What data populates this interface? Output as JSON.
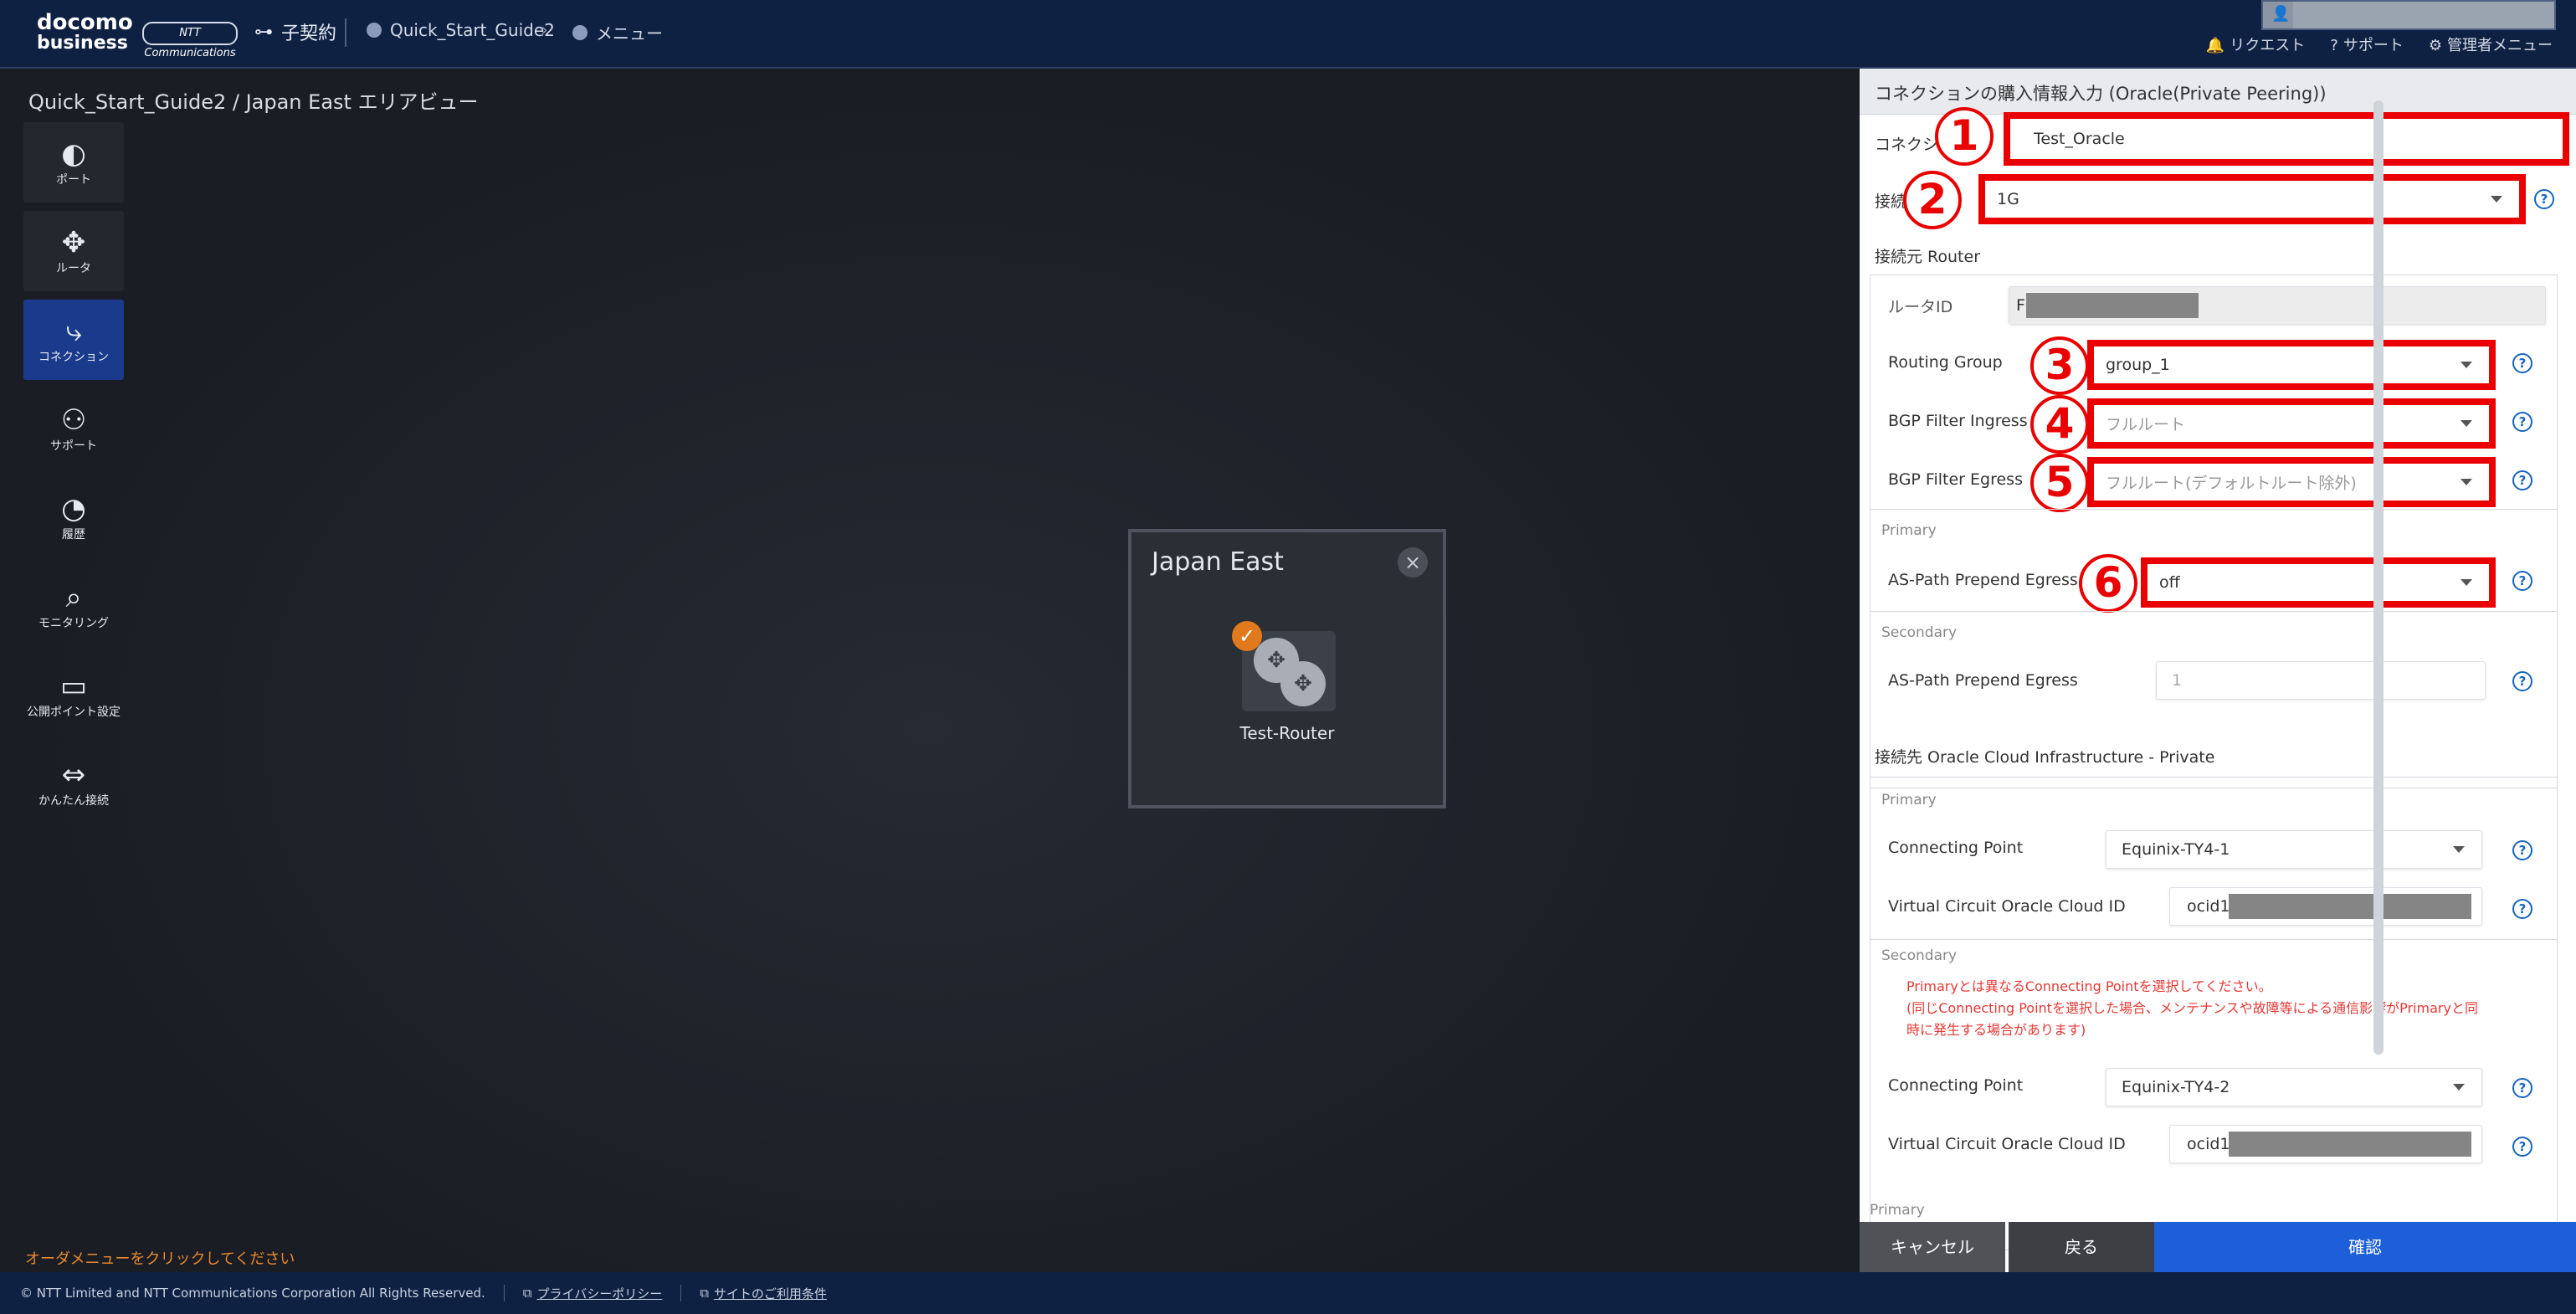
{
  "header": {
    "logo_line1": "docomo",
    "logo_line2": "business",
    "ntt_badge": "NTT Communications",
    "sub_contract": "子契約",
    "breadcrumb": [
      "Quick_Start_Guide2",
      "メニュー"
    ],
    "links": [
      "リクエスト",
      "サポート",
      "管理者メニュー"
    ]
  },
  "canvas": {
    "area_title": "Quick_Start_Guide2 / Japan East エリアビュー",
    "hint": "オーダメニューをクリックしてください",
    "popup": {
      "title": "Japan East",
      "router_name": "Test-Router"
    }
  },
  "sidebar": {
    "items": [
      {
        "label": "ポート",
        "icon": "port-icon"
      },
      {
        "label": "ルータ",
        "icon": "router-icon"
      },
      {
        "label": "コネクション",
        "icon": "connection-icon",
        "active": true
      },
      {
        "label": "サポート",
        "icon": "support-icon"
      },
      {
        "label": "履歴",
        "icon": "history-icon"
      },
      {
        "label": "モニタリング",
        "icon": "monitoring-icon"
      },
      {
        "label": "公開ポイント設定",
        "icon": "public-point-icon"
      },
      {
        "label": "かんたん接続",
        "icon": "easy-connect-icon"
      }
    ]
  },
  "panel": {
    "title": "コネクションの購入情報入力 (Oracle(Private Peering))",
    "connection_name_label": "コネクション名",
    "connection_name_value": "Test_Oracle",
    "bandwidth_label": "接続帯域",
    "bandwidth_value": "1G",
    "source_router_section": "接続元 Router",
    "router_id_label": "ルータID",
    "router_id_value": "F",
    "routing_group_label": "Routing Group",
    "routing_group_value": "group_1",
    "bgp_ingress_label": "BGP Filter Ingress",
    "bgp_ingress_value": "フルルート",
    "bgp_egress_label": "BGP Filter Egress",
    "bgp_egress_value": "フルルート(デフォルトルート除外)",
    "primary_label": "Primary",
    "aspath_label": "AS-Path Prepend Egress",
    "aspath_primary_value": "off",
    "secondary_label": "Secondary",
    "aspath_secondary_value": "1",
    "oci_section": "接続先 Oracle Cloud Infrastructure - Private",
    "connecting_point_label": "Connecting Point",
    "connecting_point_primary": "Equinix-TY4-1",
    "vc_label": "Virtual Circuit Oracle Cloud ID",
    "vc_prefix": "ocid1",
    "warning_lines": [
      "Primaryとは異なるConnecting Pointを選択してください。",
      "(同じConnecting Pointを選択した場合、メンテナンスや故障等による通信影響がPrimaryと同",
      "時に発生する場合があります)"
    ],
    "connecting_point_secondary": "Equinix-TY4-2",
    "bottom_primary_label": "Primary",
    "buttons": {
      "cancel": "キャンセル",
      "back": "戻る",
      "confirm": "確認"
    },
    "markers": [
      "1",
      "2",
      "3",
      "4",
      "5",
      "6"
    ]
  },
  "footer": {
    "copyright": "© NTT Limited and NTT Communications Corporation All Rights Reserved.",
    "privacy": "プライバシーポリシー",
    "terms": "サイトのご利用条件"
  },
  "colors": {
    "accent_red": "#ea0000",
    "primary_blue": "#1d5fd8",
    "nav_bg": "#0f2143"
  }
}
